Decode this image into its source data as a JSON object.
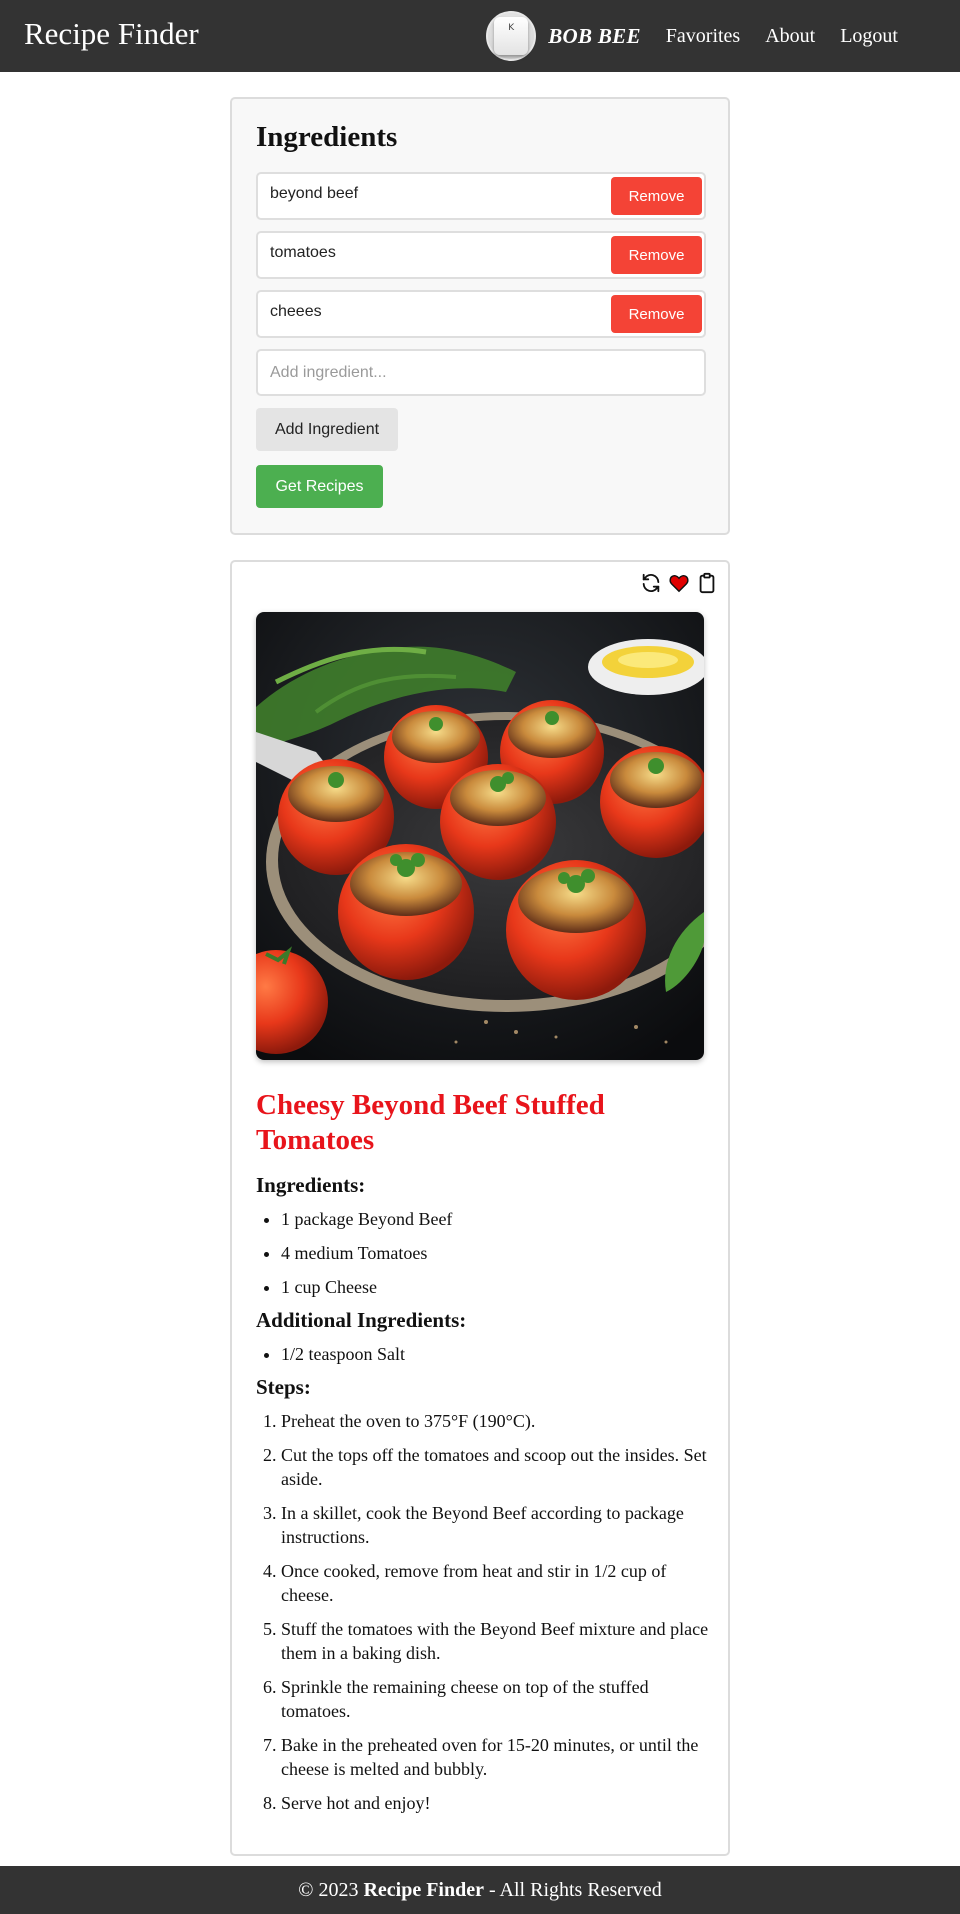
{
  "header": {
    "brand": "Recipe Finder",
    "avatar_label": "K",
    "username": "BOB BEE",
    "nav": [
      "Favorites",
      "About",
      "Logout"
    ]
  },
  "ingredients_panel": {
    "title": "Ingredients",
    "items": [
      "beyond beef",
      "tomatoes",
      "cheees"
    ],
    "remove_label": "Remove",
    "add_placeholder": "Add ingredient...",
    "add_button": "Add Ingredient",
    "get_button": "Get Recipes"
  },
  "recipe": {
    "tool_icons": [
      "refresh-icon",
      "heart-icon",
      "clipboard-icon"
    ],
    "title": "Cheesy Beyond Beef Stuffed Tomatoes",
    "ingredients_heading": "Ingredients:",
    "ingredients": [
      "1 package Beyond Beef",
      "4 medium Tomatoes",
      "1 cup Cheese"
    ],
    "additional_heading": "Additional Ingredients:",
    "additional": [
      "1/2 teaspoon Salt"
    ],
    "steps_heading": "Steps:",
    "steps": [
      "Preheat the oven to 375°F (190°C).",
      "Cut the tops off the tomatoes and scoop out the insides. Set aside.",
      "In a skillet, cook the Beyond Beef according to package instructions.",
      "Once cooked, remove from heat and stir in 1/2 cup of cheese.",
      "Stuff the tomatoes with the Beyond Beef mixture and place them in a baking dish.",
      "Sprinkle the remaining cheese on top of the stuffed tomatoes.",
      "Bake in the preheated oven for 15-20 minutes, or until the cheese is melted and bubbly.",
      "Serve hot and enjoy!"
    ]
  },
  "footer": {
    "prefix": "© 2023",
    "brand": "Recipe Finder",
    "suffix": "- All Rights Reserved"
  },
  "colors": {
    "nav_bg": "#333333",
    "remove": "#f44336",
    "get_recipes": "#4caf50",
    "recipe_title": "#e8141b",
    "heart": "#e00000"
  }
}
